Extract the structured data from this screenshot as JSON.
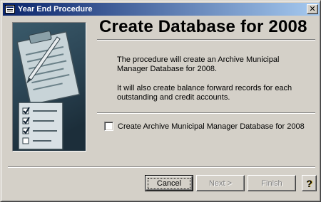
{
  "window": {
    "title": "Year End Procedure",
    "close_glyph": "✕"
  },
  "main": {
    "headline": "Create Database for 2008",
    "paragraph1": "The procedure will create an Archive Municipal Manager Database for 2008.",
    "paragraph2": "It will also create balance forward records for each outstanding and credit accounts.",
    "checkbox": {
      "label": "Create Archive Municipal Manager Database for 2008",
      "checked": false
    }
  },
  "buttons": {
    "cancel": "Cancel",
    "next": "Next >",
    "finish": "Finish",
    "help": "?"
  },
  "icons": {
    "app": "form-window-icon",
    "close": "close-icon",
    "sidebar": "clipboard-checklist-illustration",
    "help": "question-mark-icon"
  },
  "colors": {
    "titlebar_start": "#0a246a",
    "titlebar_end": "#a6caf0",
    "face": "#d4d0c8",
    "disabled_text": "#808080"
  }
}
